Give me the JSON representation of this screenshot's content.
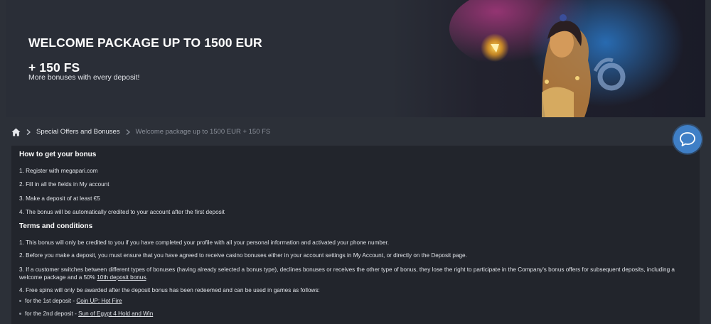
{
  "banner": {
    "title_line1": "WELCOME PACKAGE UP TO 1500 EUR",
    "title_line2": "+ 150 FS",
    "subtitle": "More bonuses with every deposit!"
  },
  "breadcrumb": {
    "home_icon": "home-icon",
    "items": [
      "Special Offers and Bonuses",
      "Welcome package up to 1500 EUR + 150 FS"
    ]
  },
  "how_to": {
    "heading": "How to get your bonus",
    "steps": [
      "1. Register with megapari.com",
      "2. Fill in all the fields in My account",
      "3. Make a deposit of at least €5",
      "4. The bonus will be automatically credited to your account after the first deposit"
    ]
  },
  "terms": {
    "heading": "Terms and conditions",
    "items": [
      "1. This bonus will only be credited to you if you have completed your profile with all your personal information and activated your phone number.",
      "2. Before you make a deposit, you must ensure that you have agreed to receive casino bonuses either in your account settings in My Account, or directly on the Deposit page.",
      "3. If a customer switches between different types of bonuses (having already selected a bonus type), declines bonuses or receives the other type of bonus, they lose the right to participate in the Company's bonus offers for subsequent deposits, including a welcome package and a 50%",
      "4. Free spins will only be awarded after the deposit bonus has been redeemed and can be used in games as follows:"
    ],
    "item3_link": "10th deposit bonus",
    "item3_end": ".",
    "free_spins": [
      {
        "prefix": "for the 1st deposit - ",
        "game": "Coin UP: Hot Fire"
      },
      {
        "prefix": "for the 2nd deposit - ",
        "game": "Sun of Egypt 4 Hold and Win"
      }
    ]
  },
  "chat": {
    "icon": "chat-bubble-icon"
  },
  "colors": {
    "accent": "#3f7fc6",
    "background": "#2c3038",
    "panel": "#22252c"
  }
}
